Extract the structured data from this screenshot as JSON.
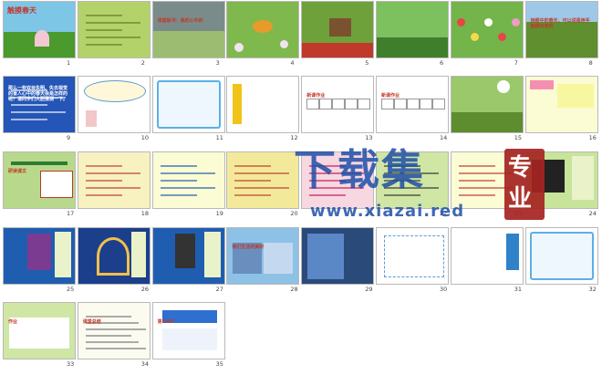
{
  "slides": [
    {
      "num": "1",
      "title": "触摸春天",
      "bg": "#7ec6e6",
      "scene": "meadow",
      "accent": "#4a9a2e"
    },
    {
      "num": "2",
      "bg": "#b3d36a",
      "scene": "text",
      "accent": "#5b7a23"
    },
    {
      "num": "3",
      "bg": "#9cbc72",
      "scene": "photo",
      "accent": "#6d8a4c",
      "caption": "课堂板书：我的心中的"
    },
    {
      "num": "4",
      "bg": "#7fb84d",
      "scene": "butterfly",
      "accent": "#e79b2a"
    },
    {
      "num": "5",
      "bg": "#6fa13b",
      "scene": "house",
      "accent": "#c0392b"
    },
    {
      "num": "6",
      "bg": "#4e9c3b",
      "scene": "forest",
      "accent": "#2f6b22"
    },
    {
      "num": "7",
      "bg": "#73b44b",
      "scene": "flowers",
      "accent": "#e54747"
    },
    {
      "num": "8",
      "bg": "#5f8f2e",
      "scene": "field",
      "accent": "#3d6b1a",
      "caption": "她眼中的春天，可以说是用手触摸出来的"
    },
    {
      "num": "9",
      "bg": "#2455b7",
      "scene": "text",
      "accent": "#ffffff",
      "caption": "那么一些双目失明、失去视觉的盲人心中的春天会是怎样的呢？请同学们大胆猜测一下。"
    },
    {
      "num": "10",
      "bg": "#ffffff",
      "scene": "bubble",
      "accent": "#5b9bd5"
    },
    {
      "num": "11",
      "bg": "#ffffff",
      "scene": "frame",
      "accent": "#5bb0e6"
    },
    {
      "num": "12",
      "bg": "#ffffff",
      "scene": "list",
      "accent": "#f0c419"
    },
    {
      "num": "13",
      "bg": "#ffffff",
      "scene": "pinyin",
      "accent": "#d64541",
      "caption": "新课作业"
    },
    {
      "num": "14",
      "bg": "#ffffff",
      "scene": "pinyin2",
      "accent": "#d64541",
      "caption": "新课作业"
    },
    {
      "num": "15",
      "bg": "#9bc86b",
      "scene": "meadow2",
      "accent": "#5d8d2f"
    },
    {
      "num": "16",
      "bg": "#fbfbd4",
      "scene": "yellowtext",
      "accent": "#c0392b"
    },
    {
      "num": "17",
      "bg": "#b8d98b",
      "scene": "text2",
      "accent": "#2e7d32",
      "caption": "研读课文"
    },
    {
      "num": "18",
      "bg": "#f7f2c0",
      "scene": "text",
      "accent": "#c0392b"
    },
    {
      "num": "19",
      "bg": "#fbfbd4",
      "scene": "text",
      "accent": "#1e5aa8"
    },
    {
      "num": "20",
      "bg": "#f2ea9a",
      "scene": "text",
      "accent": "#c0392b"
    },
    {
      "num": "21",
      "bg": "#f7d7e0",
      "scene": "text",
      "accent": "#c2185b"
    },
    {
      "num": "22",
      "bg": "#cfe6a4",
      "scene": "text",
      "accent": "#333333"
    },
    {
      "num": "23",
      "bg": "#fbfbd4",
      "scene": "text",
      "accent": "#c0392b"
    },
    {
      "num": "24",
      "bg": "#c7e49a",
      "scene": "piano",
      "accent": "#1e5aa8"
    },
    {
      "num": "25",
      "bg": "#1f5db0",
      "scene": "portrait",
      "accent": "#f7d34a"
    },
    {
      "num": "26",
      "bg": "#1c3f8c",
      "scene": "arch",
      "accent": "#f2c04a"
    },
    {
      "num": "27",
      "bg": "#1f5db0",
      "scene": "portrait2",
      "accent": "#f7d34a"
    },
    {
      "num": "28",
      "bg": "#8ec1e6",
      "scene": "collage",
      "accent": "#d93b3b",
      "caption": "我们生活的美好"
    },
    {
      "num": "29",
      "bg": "#2a4a7a",
      "scene": "sport",
      "accent": "#ffd54f"
    },
    {
      "num": "30",
      "bg": "#ffffff",
      "scene": "quote",
      "accent": "#5b9bd5"
    },
    {
      "num": "31",
      "bg": "#ffffff",
      "scene": "badge",
      "accent": "#2f82c8"
    },
    {
      "num": "32",
      "bg": "#ffffff",
      "scene": "frame2",
      "accent": "#5bb0e6"
    },
    {
      "num": "33",
      "bg": "#cfe6a4",
      "scene": "homework",
      "accent": "#333333",
      "caption": "作业"
    },
    {
      "num": "34",
      "bg": "#fbfbf0",
      "scene": "doc",
      "accent": "#666666",
      "caption": "课堂总结"
    },
    {
      "num": "35",
      "bg": "#ffffff",
      "scene": "logo",
      "accent": "#2f6fd0",
      "caption": "第1PPT"
    }
  ],
  "watermark": {
    "main": "下载集",
    "url": "www.xiazai.red",
    "badge": [
      "专",
      "业"
    ]
  },
  "colors": {
    "watermark": "#1f4fa8",
    "badge": "#a62422"
  }
}
